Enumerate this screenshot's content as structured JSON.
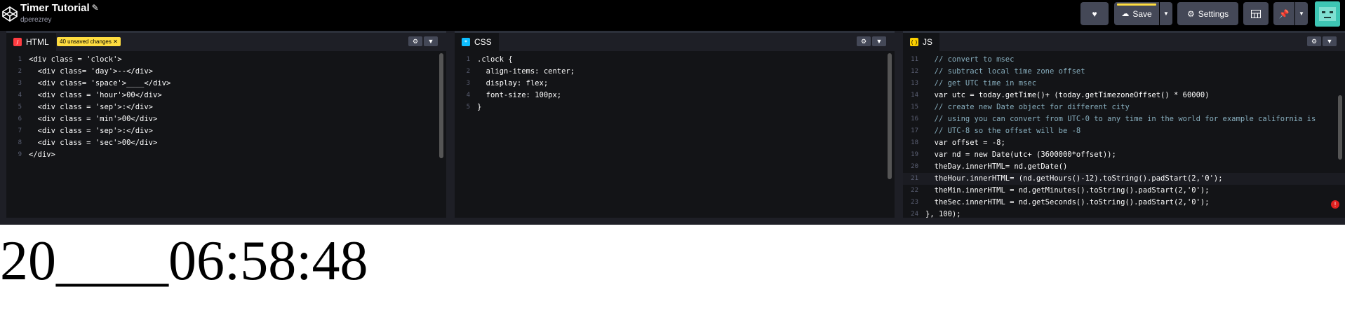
{
  "header": {
    "title": "Timer Tutorial",
    "author": "dperezrey",
    "save_label": "Save",
    "settings_label": "Settings"
  },
  "html_editor": {
    "tab_label": "HTML",
    "unsaved_label": "40 unsaved changes",
    "lines": [
      {
        "n": "1",
        "text": "<div class = 'clock'>"
      },
      {
        "n": "2",
        "text": "  <div class= 'day'>--</div>"
      },
      {
        "n": "3",
        "text": "  <div class= 'space'>____</div>"
      },
      {
        "n": "4",
        "text": "  <div class = 'hour'>00</div>"
      },
      {
        "n": "5",
        "text": "  <div class = 'sep'>:</div>"
      },
      {
        "n": "6",
        "text": "  <div class = 'min'>00</div>"
      },
      {
        "n": "7",
        "text": "  <div class = 'sep'>:</div>"
      },
      {
        "n": "8",
        "text": "  <div class = 'sec'>00</div>"
      },
      {
        "n": "9",
        "text": "</div>"
      }
    ]
  },
  "css_editor": {
    "tab_label": "CSS",
    "lines": [
      {
        "n": "1",
        "text": ".clock {"
      },
      {
        "n": "2",
        "text": "  align-items: center;"
      },
      {
        "n": "3",
        "text": "  display: flex;"
      },
      {
        "n": "4",
        "text": "  font-size: 100px;"
      },
      {
        "n": "5",
        "text": "}"
      }
    ]
  },
  "js_editor": {
    "tab_label": "JS",
    "lines": [
      {
        "n": "11",
        "text": "  // convert to msec"
      },
      {
        "n": "12",
        "text": "  // subtract local time zone offset"
      },
      {
        "n": "13",
        "text": "  // get UTC time in msec"
      },
      {
        "n": "14",
        "text": "  var utc = today.getTime()+ (today.getTimezoneOffset() * 60000)"
      },
      {
        "n": "15",
        "text": "  // create new Date object for different city"
      },
      {
        "n": "16",
        "text": "  // using you can convert from UTC-0 to any time in the world for example california is"
      },
      {
        "n": "17",
        "text": "  // UTC-8 so the offset will be -8"
      },
      {
        "n": "18",
        "text": "  var offset = -8;"
      },
      {
        "n": "19",
        "text": "  var nd = new Date(utc+ (3600000*offset));"
      },
      {
        "n": "20",
        "text": "  theDay.innerHTML= nd.getDate()"
      },
      {
        "n": "21",
        "text": "  theHour.innerHTML= (nd.getHours()-12).toString().padStart(2,'0');"
      },
      {
        "n": "22",
        "text": "  theMin.innerHTML = nd.getMinutes().toString().padStart(2,'0');"
      },
      {
        "n": "23",
        "text": "  theSec.innerHTML = nd.getSeconds().toString().padStart(2,'0');"
      },
      {
        "n": "24",
        "text": "}, 100);"
      }
    ]
  },
  "result": {
    "day": "20",
    "space": "____",
    "hour": "06",
    "sep1": ":",
    "min": "58",
    "sep2": ":",
    "sec": "48"
  },
  "colors": {
    "accent_yellow": "#ffdd40",
    "html_badge": "#ff3c41",
    "css_badge": "#0ebeff",
    "js_badge": "#fcd000",
    "button_bg": "#444857"
  }
}
